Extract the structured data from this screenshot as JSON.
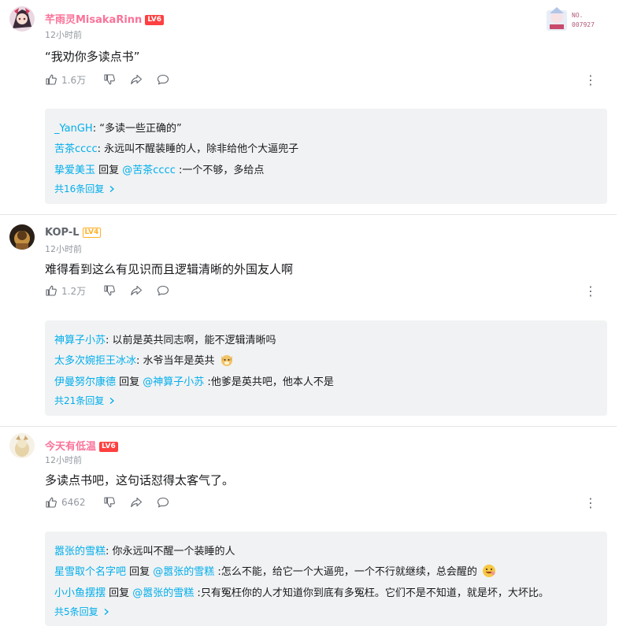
{
  "comments": [
    {
      "username": "芊雨灵MisakaRinn",
      "level": "LV6",
      "time": "12小时前",
      "content": "“我劝你多读点书”",
      "likes": "1.6万",
      "badge_no": "NO.",
      "badge_num": "007927",
      "replies": [
        {
          "name": "_YanGH",
          "sep": ": ",
          "text": "“多读一些正确的”"
        },
        {
          "name": "苦茶cccc",
          "sep": ": ",
          "text": "永远叫不醒装睡的人，除非给他个大逼兜子"
        },
        {
          "name": "挚爱美玉",
          "mid": " 回复 ",
          "target": "@苦茶cccc",
          "sep": " :",
          "text": "一个不够，多给点"
        }
      ],
      "more_replies": "共16条回复"
    },
    {
      "username": "KOP-L",
      "level": "LV4",
      "time": "12小时前",
      "content": "难得看到这么有见识而且逻辑清晰的外国友人啊",
      "likes": "1.2万",
      "replies": [
        {
          "name": "神算子小苏",
          "sep": ": ",
          "text": "以前是英共同志啊，能不逻辑清晰吗"
        },
        {
          "name": "太多次婉拒王冰冰",
          "sep": ": ",
          "text": "水爷当年是英共"
        },
        {
          "name": "伊曼努尔康德",
          "mid": " 回复 ",
          "target": "@神算子小苏",
          "sep": " :",
          "text": "他爹是英共吧，他本人不是"
        }
      ],
      "more_replies": "共21条回复"
    },
    {
      "username": "今天有低温",
      "level": "LV6",
      "time": "12小时前",
      "content": "多读点书吧，这句话怼得太客气了。",
      "likes": "6462",
      "replies": [
        {
          "name": "嚣张的雪糕",
          "sep": ": ",
          "text": "你永远叫不醒一个装睡的人"
        },
        {
          "name": "星雪取个名字吧",
          "mid": " 回复 ",
          "target": "@嚣张的雪糕",
          "sep": " :",
          "text": "怎么不能，给它一个大逼兜，一个不行就继续，总会醒的"
        },
        {
          "name": "小小鱼摆摆",
          "mid": " 回复 ",
          "target": "@嚣张的雪糕",
          "sep": " :",
          "text": "只有冤枉你的人才知道你到底有多冤枉。它们不是不知道，就是坏，大坏比。"
        }
      ],
      "more_replies": "共5条回复"
    }
  ],
  "colors": {
    "vip_name": "#fb7299",
    "normal_name": "#61666d",
    "link": "#00aeec",
    "lv6": "#ff4040",
    "lv4": "#ffb027"
  },
  "icons": [
    "like-icon",
    "dislike-icon",
    "share-icon",
    "reply-icon",
    "more-icon",
    "chevron-right-icon"
  ]
}
